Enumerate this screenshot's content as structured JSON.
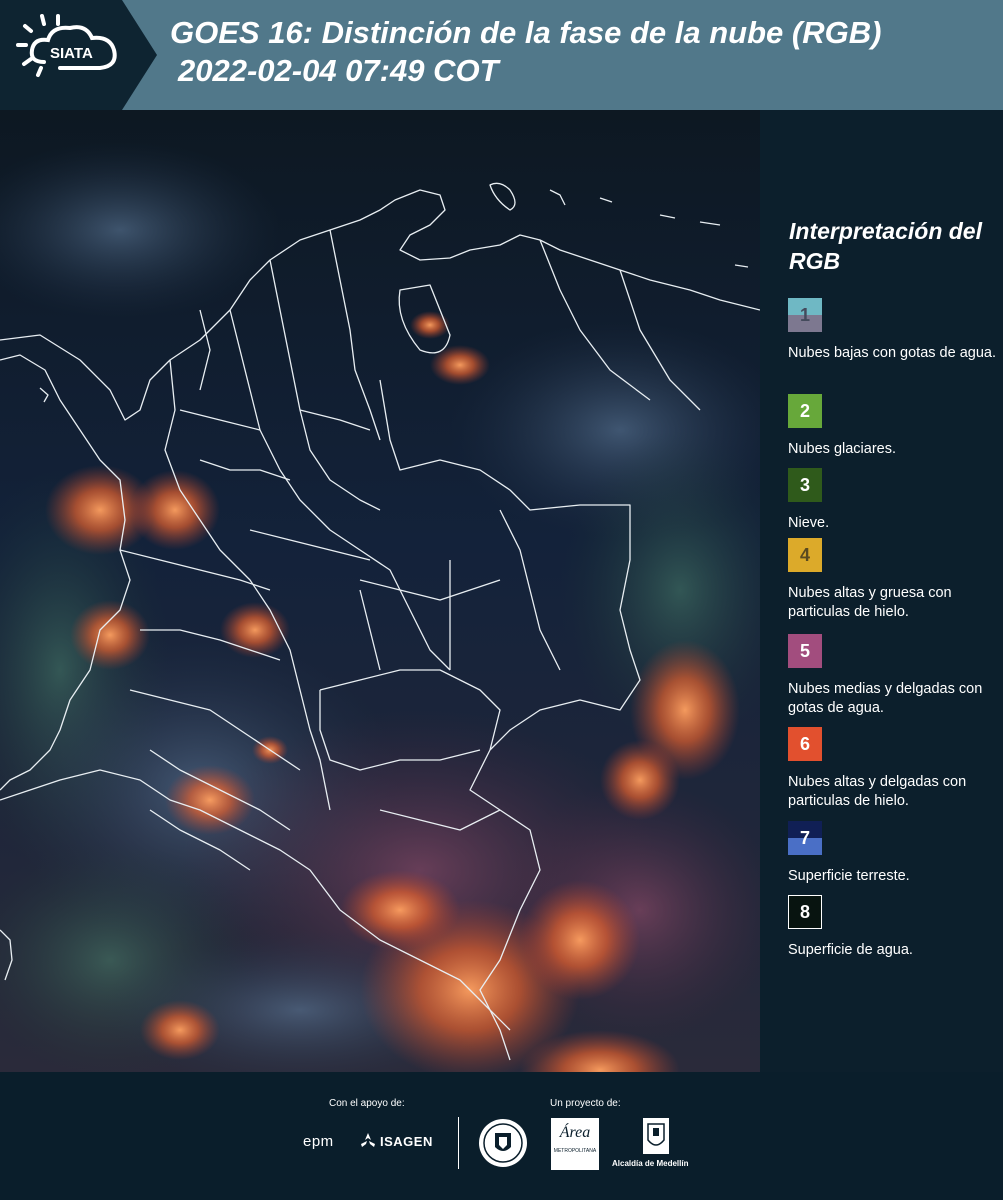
{
  "header": {
    "logo_text": "SIATA",
    "title_line1": "GOES 16: Distinción de la fase de la nube (RGB)",
    "title_line2": "2022-02-04 07:49 COT"
  },
  "legend": {
    "title": "Interpretación del RGB",
    "items": [
      {
        "number": "1",
        "label": "Nubes bajas con gotas de agua.",
        "color_top": "#6fb8c4",
        "color_bottom": "#7d7890"
      },
      {
        "number": "2",
        "label": "Nubes glaciares.",
        "color": "#67a83a"
      },
      {
        "number": "3",
        "label": "Nieve.",
        "color": "#2f5a1b"
      },
      {
        "number": "4",
        "label": "Nubes altas y gruesa con particulas de hielo.",
        "color": "#dcaa2a"
      },
      {
        "number": "5",
        "label": "Nubes medias y delgadas con gotas de agua.",
        "color": "#a24d7e"
      },
      {
        "number": "6",
        "label": "Nubes altas y delgadas con particulas de hielo.",
        "color": "#e2502e"
      },
      {
        "number": "7",
        "label": "Superficie terreste.",
        "color_top": "#101f55",
        "color_bottom": "#4a6fc6"
      },
      {
        "number": "8",
        "label": "Superficie de agua.",
        "color": "#081410"
      }
    ]
  },
  "footer": {
    "support_label": "Con el apoyo de:",
    "project_label": "Un proyecto de:",
    "sponsor_1": "epm",
    "sponsor_2": "ISAGEN",
    "area_logo_text": "Área",
    "area_sub_text": "METROPOLITANA",
    "alcaldia_label": "Alcaldía de Medellín"
  }
}
